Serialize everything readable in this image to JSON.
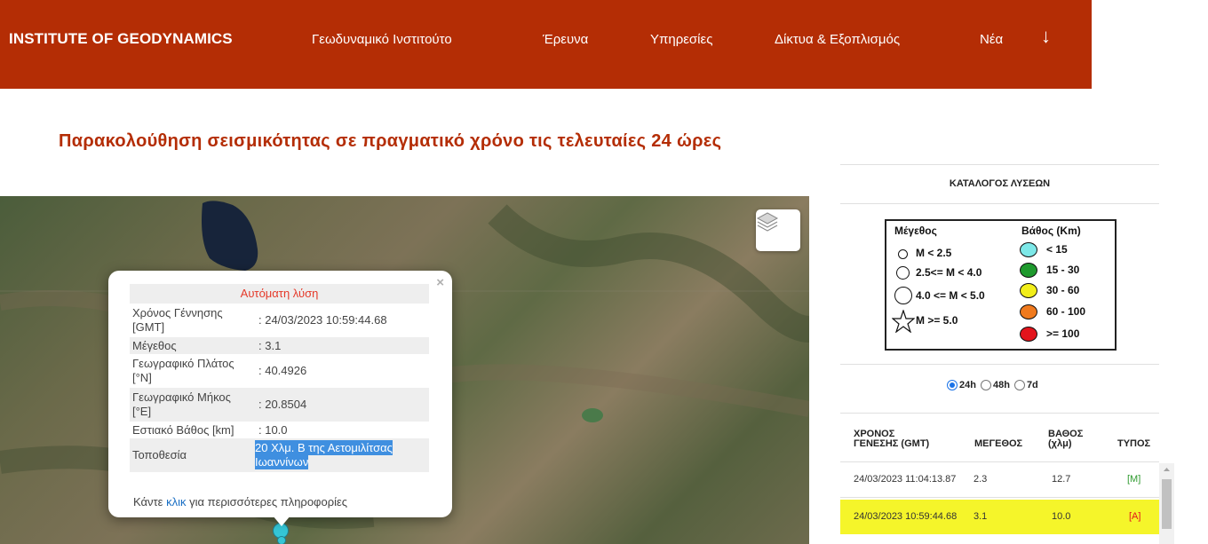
{
  "header": {
    "brand": "INSTITUTE OF GEODYNAMICS",
    "nav": [
      "Γεωδυναμικό Ινστιτούτο",
      "Έρευνα",
      "Υπηρεσίες",
      "Δίκτυα & Εξοπλισμός",
      "Νέα"
    ],
    "arrow": "↓"
  },
  "page_title": "Παρακολούθηση σεισμικότητας σε πραγματικό χρόνο τις τελευταίες 24 ώρες",
  "popup": {
    "close": "×",
    "heading": "Αυτόματη λύση",
    "rows": [
      {
        "label": "Χρόνος Γέννησης [GMT]",
        "value": ": 24/03/2023 10:59:44.68"
      },
      {
        "label": "Μέγεθος",
        "value": ": 3.1"
      },
      {
        "label": "Γεωγραφικό Πλάτος [°N]",
        "value": ": 40.4926"
      },
      {
        "label": "Γεωγραφικό Μήκος [°E]",
        "value": ": 20.8504"
      },
      {
        "label": "Εστιακό Βάθος [km]",
        "value": ": 10.0"
      },
      {
        "label": "Τοποθεσία",
        "value": " 20 Χλμ. Β της Αετομιλίτσας Ιωαννίνων"
      }
    ],
    "more_prefix": "Κάντε ",
    "more_link": "κλικ",
    "more_suffix": " για περισσότερες πληροφορίες"
  },
  "sidebar": {
    "catalog_title": "ΚΑΤΑΛΟΓΟΣ ΛΥΣΕΩΝ",
    "legend": {
      "magnitude_title": "Μέγεθος",
      "depth_title": "Βάθος (Km)",
      "magnitude_items": [
        "M < 2.5",
        "2.5<= M < 4.0",
        "4.0 <= M < 5.0",
        "M >= 5.0"
      ],
      "depth_items": [
        {
          "label": "< 15",
          "color": "#7de8e8"
        },
        {
          "label": "15 - 30",
          "color": "#1f9a2e"
        },
        {
          "label": "30 - 60",
          "color": "#f2ee1a"
        },
        {
          "label": "60 - 100",
          "color": "#f07a1e"
        },
        {
          "label": ">= 100",
          "color": "#e3141c"
        }
      ]
    },
    "periods": [
      "24h",
      "48h",
      "7d"
    ],
    "selected_period": "24h",
    "table": {
      "headers": [
        "ΧΡΟΝΟΣ ΓΕΝΕΣΗΣ (GMT)",
        "ΜΕΓΕΘΟΣ",
        "ΒΑΘΟΣ (χλμ)",
        "ΤΥΠΟΣ"
      ],
      "header_lines": {
        "time": [
          "ΧΡΟΝΟΣ",
          "ΓΕΝΕΣΗΣ (GMT)"
        ],
        "mag": [
          "ΜΕΓΕΘΟΣ"
        ],
        "depth": [
          "ΒΑΘΟΣ",
          "(χλμ)"
        ],
        "type": [
          "ΤΥΠΟΣ"
        ]
      },
      "rows": [
        {
          "time": "24/03/2023 11:04:13.87",
          "mag": "2.3",
          "depth": "12.7",
          "type": "[M]",
          "type_color": "#2e9a2e",
          "selected": false
        },
        {
          "time": "24/03/2023 10:59:44.68",
          "mag": "3.1",
          "depth": "10.0",
          "type": "[A]",
          "type_color": "#e3141c",
          "selected": true
        }
      ]
    }
  }
}
